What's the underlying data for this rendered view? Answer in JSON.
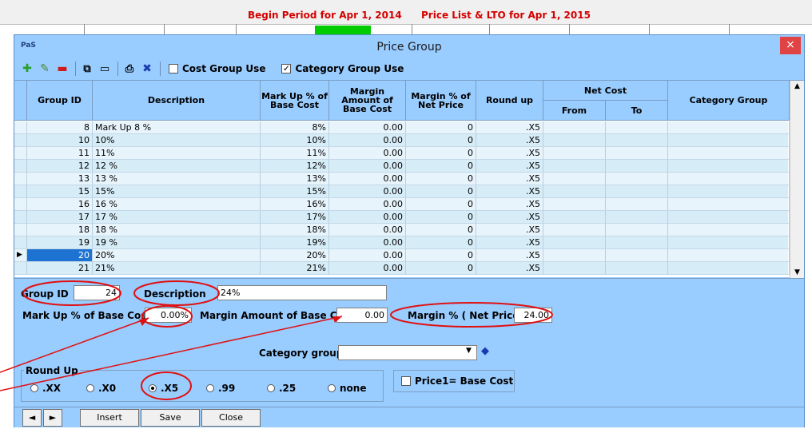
{
  "background": {
    "begin_period": "Begin Period for  Apr 1, 2014",
    "price_list": "Price List & LTO for  Apr 1, 2015"
  },
  "dialog": {
    "app_icon": "PaS",
    "title": "Price Group",
    "close_label": "×"
  },
  "toolbar": {
    "cost_group_use": "Cost Group Use",
    "category_group_use": "Category Group Use",
    "cost_group_checked": false,
    "category_group_checked": true
  },
  "grid": {
    "headers": {
      "group_id": "Group ID",
      "description": "Description",
      "markup": "Mark Up % of Base Cost",
      "margin_amount": "Margin Amount of Base Cost",
      "margin_pct": "Margin % of Net Price",
      "round_up": "Round up",
      "net_cost": "Net Cost",
      "from": "From",
      "to": "To",
      "category_group": "Category Group"
    },
    "rows": [
      {
        "id": "8",
        "desc": "Mark Up 8 %",
        "markup": "8%",
        "margin_amt": "0.00",
        "margin_pct": "0",
        "round": ".X5"
      },
      {
        "id": "10",
        "desc": "10%",
        "markup": "10%",
        "margin_amt": "0.00",
        "margin_pct": "0",
        "round": ".X5"
      },
      {
        "id": "11",
        "desc": "11%",
        "markup": "11%",
        "margin_amt": "0.00",
        "margin_pct": "0",
        "round": ".X5"
      },
      {
        "id": "12",
        "desc": "12 %",
        "markup": "12%",
        "margin_amt": "0.00",
        "margin_pct": "0",
        "round": ".X5"
      },
      {
        "id": "13",
        "desc": "13 %",
        "markup": "13%",
        "margin_amt": "0.00",
        "margin_pct": "0",
        "round": ".X5"
      },
      {
        "id": "15",
        "desc": "15%",
        "markup": "15%",
        "margin_amt": "0.00",
        "margin_pct": "0",
        "round": ".X5"
      },
      {
        "id": "16",
        "desc": "16 %",
        "markup": "16%",
        "margin_amt": "0.00",
        "margin_pct": "0",
        "round": ".X5"
      },
      {
        "id": "17",
        "desc": "17 %",
        "markup": "17%",
        "margin_amt": "0.00",
        "margin_pct": "0",
        "round": ".X5"
      },
      {
        "id": "18",
        "desc": "18 %",
        "markup": "18%",
        "margin_amt": "0.00",
        "margin_pct": "0",
        "round": ".X5"
      },
      {
        "id": "19",
        "desc": "19 %",
        "markup": "19%",
        "margin_amt": "0.00",
        "margin_pct": "0",
        "round": ".X5"
      },
      {
        "id": "20",
        "desc": "20%",
        "markup": "20%",
        "margin_amt": "0.00",
        "margin_pct": "0",
        "round": ".X5"
      },
      {
        "id": "21",
        "desc": "21%",
        "markup": "21%",
        "margin_amt": "0.00",
        "margin_pct": "0",
        "round": ".X5"
      }
    ],
    "selected_index": 10
  },
  "form": {
    "group_id_label": "Group ID",
    "group_id_value": "24",
    "description_label": "Description",
    "description_value": "24%",
    "markup_label": "Mark Up % of Base Cost",
    "markup_value": "0.00%",
    "margin_amount_label": "Margin Amount of Base Cost",
    "margin_amount_value": "0.00",
    "margin_pct_label": "Margin % ( Net Price)",
    "margin_pct_value": "24.00",
    "category_group_label": "Category group",
    "category_group_value": "",
    "round_up_label": "Round Up",
    "round_options": [
      ".XX",
      ".X0",
      ".X5",
      ".99",
      ".25",
      "none"
    ],
    "round_selected": ".X5",
    "price1_label": "Price1= Base Cost"
  },
  "buttons": {
    "prev": "◄",
    "next": "►",
    "insert": "Insert",
    "save": "Save",
    "close": "Close"
  },
  "colors": {
    "dialog_bg": "#99ccff",
    "annotation_red": "#e01010",
    "selected_row": "#1e73d2"
  }
}
